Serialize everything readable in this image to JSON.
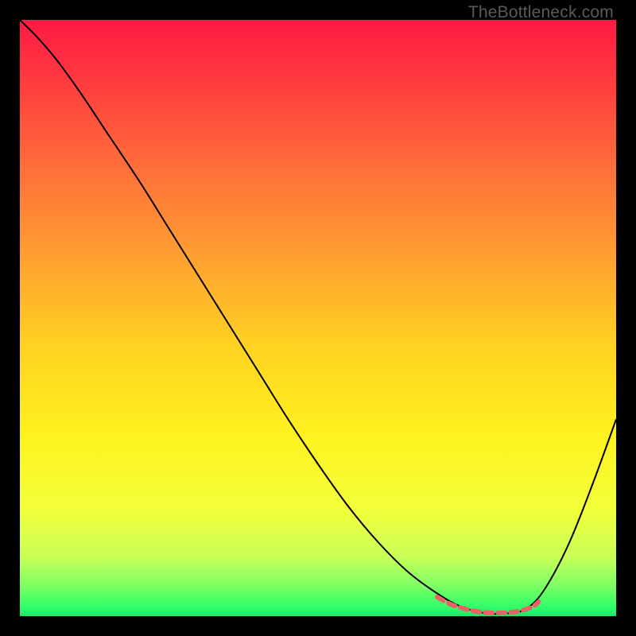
{
  "watermark": "TheBottleneck.com",
  "chart_data": {
    "type": "line",
    "title": "",
    "xlabel": "",
    "ylabel": "",
    "xlim": [
      0,
      100
    ],
    "ylim": [
      0,
      100
    ],
    "background_gradient": {
      "stops": [
        {
          "offset": 0.0,
          "color": "#ff1a44"
        },
        {
          "offset": 0.1,
          "color": "#ff3a3f"
        },
        {
          "offset": 0.25,
          "color": "#ff6f3a"
        },
        {
          "offset": 0.4,
          "color": "#ffa031"
        },
        {
          "offset": 0.55,
          "color": "#ffd321"
        },
        {
          "offset": 0.7,
          "color": "#fff220"
        },
        {
          "offset": 0.82,
          "color": "#f3ff3a"
        },
        {
          "offset": 0.9,
          "color": "#c9ff57"
        },
        {
          "offset": 0.95,
          "color": "#7cff64"
        },
        {
          "offset": 0.985,
          "color": "#2fff6a"
        },
        {
          "offset": 1.0,
          "color": "#18e86e"
        }
      ]
    },
    "series": [
      {
        "name": "bottleneck-curve",
        "stroke": "#000000",
        "stroke_width": 2,
        "x": [
          0,
          3,
          6,
          10,
          15,
          20,
          25,
          30,
          35,
          40,
          45,
          50,
          55,
          60,
          65,
          70,
          74,
          78,
          82,
          85,
          88,
          92,
          96,
          100
        ],
        "y": [
          100,
          97,
          93.5,
          88,
          80.5,
          73,
          65,
          57,
          49,
          41,
          33,
          25.5,
          18.5,
          12.5,
          7.5,
          3.8,
          1.6,
          0.5,
          0.5,
          1.3,
          4.5,
          12,
          22,
          33
        ]
      },
      {
        "name": "optimal-segment",
        "stroke": "#e86464",
        "stroke_width": 6,
        "dash": "9 7",
        "linecap": "round",
        "x": [
          70,
          72,
          74,
          76,
          78,
          80,
          82,
          84,
          86,
          87
        ],
        "y": [
          3.2,
          2.1,
          1.4,
          0.9,
          0.6,
          0.55,
          0.6,
          0.9,
          1.6,
          2.4
        ]
      }
    ]
  }
}
